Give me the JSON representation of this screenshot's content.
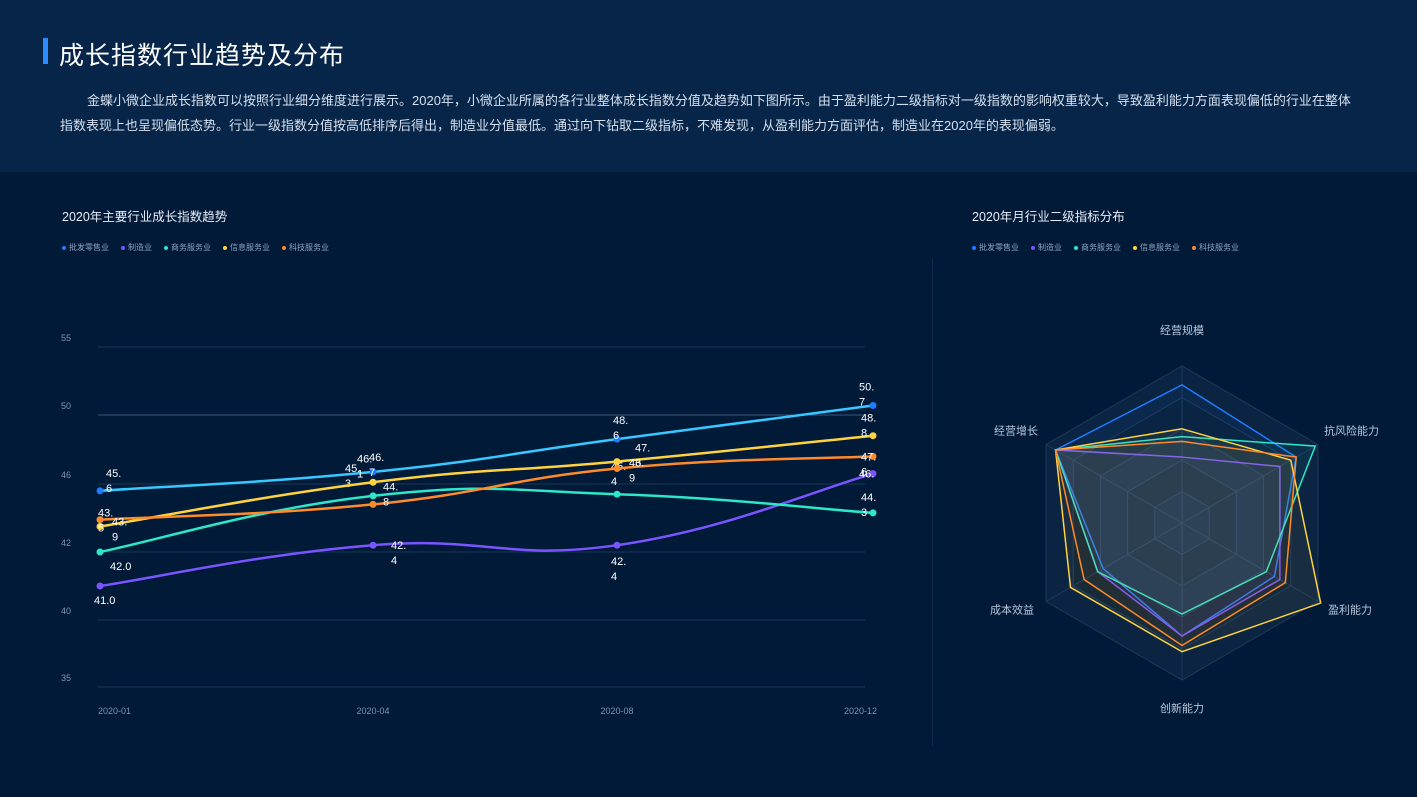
{
  "header": {
    "title": "成长指数行业趋势及分布",
    "description": "金蝶小微企业成长指数可以按照行业细分维度进行展示。2020年，小微企业所属的各行业整体成长指数分值及趋势如下图所示。由于盈利能力二级指标对一级指数的影响权重较大，导致盈利能力方面表现偏低的行业在整体指数表现上也呈现偏低态势。行业一级指数分值按高低排序后得出，制造业分值最低。通过向下钻取二级指标，不难发现，从盈利能力方面评估，制造业在2020年的表现偏弱。"
  },
  "colors": {
    "批发零售业": "#1f7bff",
    "制造业": "#7a55ff",
    "商务服务业": "#2ee6c8",
    "信息服务业": "#ffd23f",
    "科技服务业": "#ff8a2a",
    "trend_top_line": "#38c8ff"
  },
  "chart_data": [
    {
      "type": "line",
      "title": "2020年主要行业成长指数趋势",
      "legend": [
        "批发零售业",
        "制造业",
        "商务服务业",
        "信息服务业",
        "科技服务业"
      ],
      "legend_position": "top-left",
      "x": [
        "2020-01",
        "2020-04",
        "2020-08",
        "2020-12"
      ],
      "yticks": [
        35,
        40,
        42,
        46,
        50,
        55
      ],
      "grid": true,
      "series": [
        {
          "name": "批发零售业",
          "values": [
            45.6,
            46.7,
            48.6,
            50.7
          ],
          "labels": [
            "45.\n6",
            "46.\n7",
            "48.\n6",
            "50.\n7"
          ]
        },
        {
          "name": "制造业",
          "values": [
            41.0,
            42.4,
            42.4,
            46.6
          ],
          "labels": [
            "41.0",
            "42.\n4",
            "42.\n4",
            "46."
          ]
        },
        {
          "name": "商务服务业",
          "values": [
            42.0,
            45.3,
            45.4,
            44.3
          ],
          "labels": [
            "42.0",
            "45.\n3",
            "45.\n4",
            "44.\n3"
          ]
        },
        {
          "name": "信息服务业",
          "values": [
            43.5,
            46.1,
            47.3,
            48.8
          ],
          "labels": [
            "43.\n5",
            "46.\n1",
            "47.\n3",
            "48.\n8"
          ]
        },
        {
          "name": "科技服务业",
          "values": [
            43.9,
            44.8,
            46.9,
            47.6
          ],
          "labels": [
            "43.\n9",
            "44.\n8",
            "46.\n9",
            "47.\n6"
          ]
        }
      ]
    },
    {
      "type": "radar",
      "title": "2020年月行业二级指标分布",
      "legend": [
        "批发零售业",
        "制造业",
        "商务服务业",
        "信息服务业",
        "科技服务业"
      ],
      "legend_position": "top-left",
      "indicators": [
        "经营规模",
        "抗风险能力",
        "盈利能力",
        "创新能力",
        "成本效益",
        "经营增长"
      ],
      "series": [
        {
          "name": "批发零售业",
          "values": [
            0.88,
            0.84,
            0.68,
            0.72,
            0.58,
            0.93
          ]
        },
        {
          "name": "制造业",
          "values": [
            0.42,
            0.72,
            0.72,
            0.72,
            0.62,
            0.93
          ]
        },
        {
          "name": "商务服务业",
          "values": [
            0.55,
            0.98,
            0.62,
            0.58,
            0.62,
            0.93
          ]
        },
        {
          "name": "信息服务业",
          "values": [
            0.6,
            0.8,
            1.02,
            0.82,
            0.82,
            0.93
          ]
        },
        {
          "name": "科技服务业",
          "values": [
            0.52,
            0.84,
            0.76,
            0.78,
            0.72,
            0.93
          ]
        }
      ]
    }
  ]
}
